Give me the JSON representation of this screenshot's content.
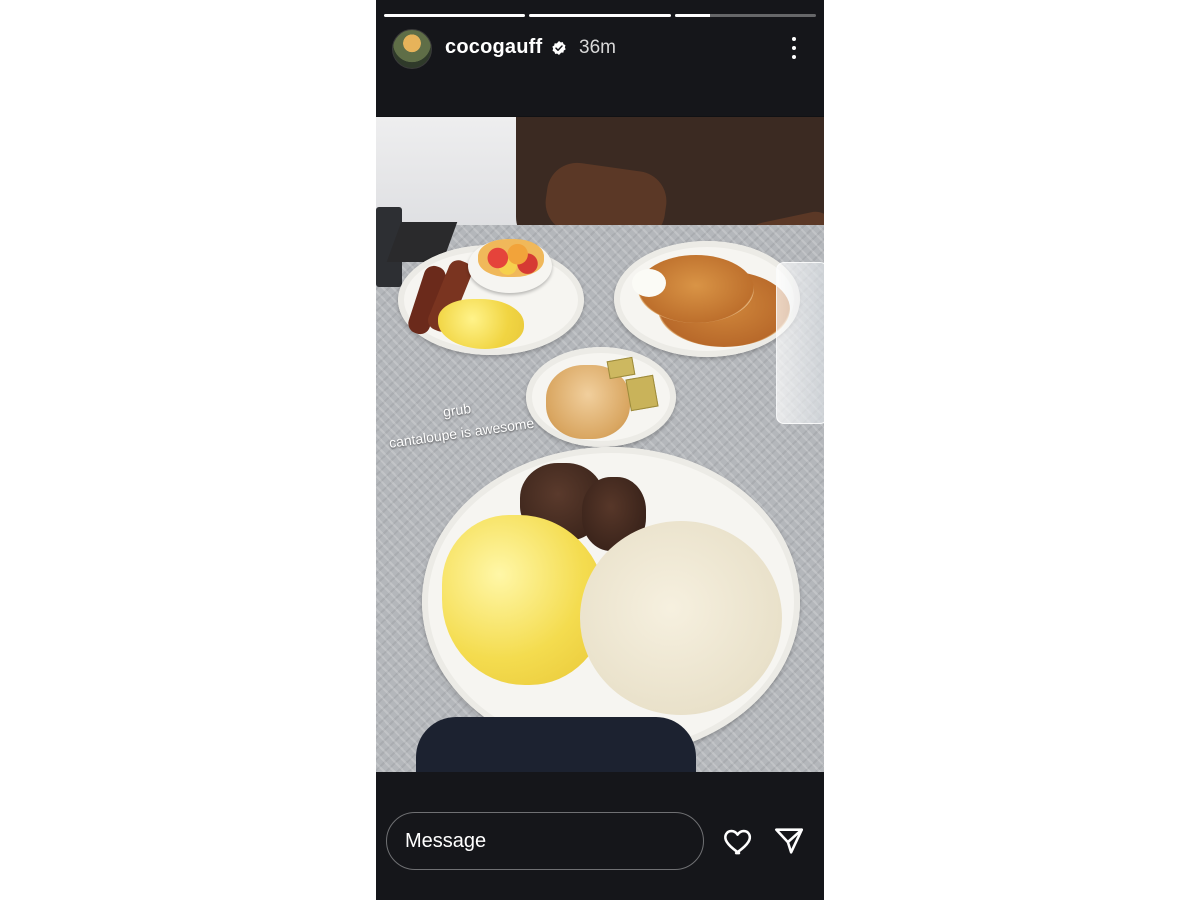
{
  "story": {
    "progress": [
      1,
      1,
      0.25
    ],
    "user": {
      "username": "cocogauff",
      "verified_icon": "verified-badge-icon",
      "time": "36m",
      "avatar": "avatar-icon"
    },
    "menu_icon": "more-options-icon",
    "captions": {
      "line1": "grub",
      "line2": "cantaloupe is awesome"
    },
    "footer": {
      "message_placeholder": "Message",
      "like_icon": "heart-icon",
      "share_icon": "send-icon"
    }
  },
  "colors": {
    "background": "#101114",
    "text": "#ffffff",
    "muted": "#d8d8d8",
    "verified": "#ffffff"
  }
}
